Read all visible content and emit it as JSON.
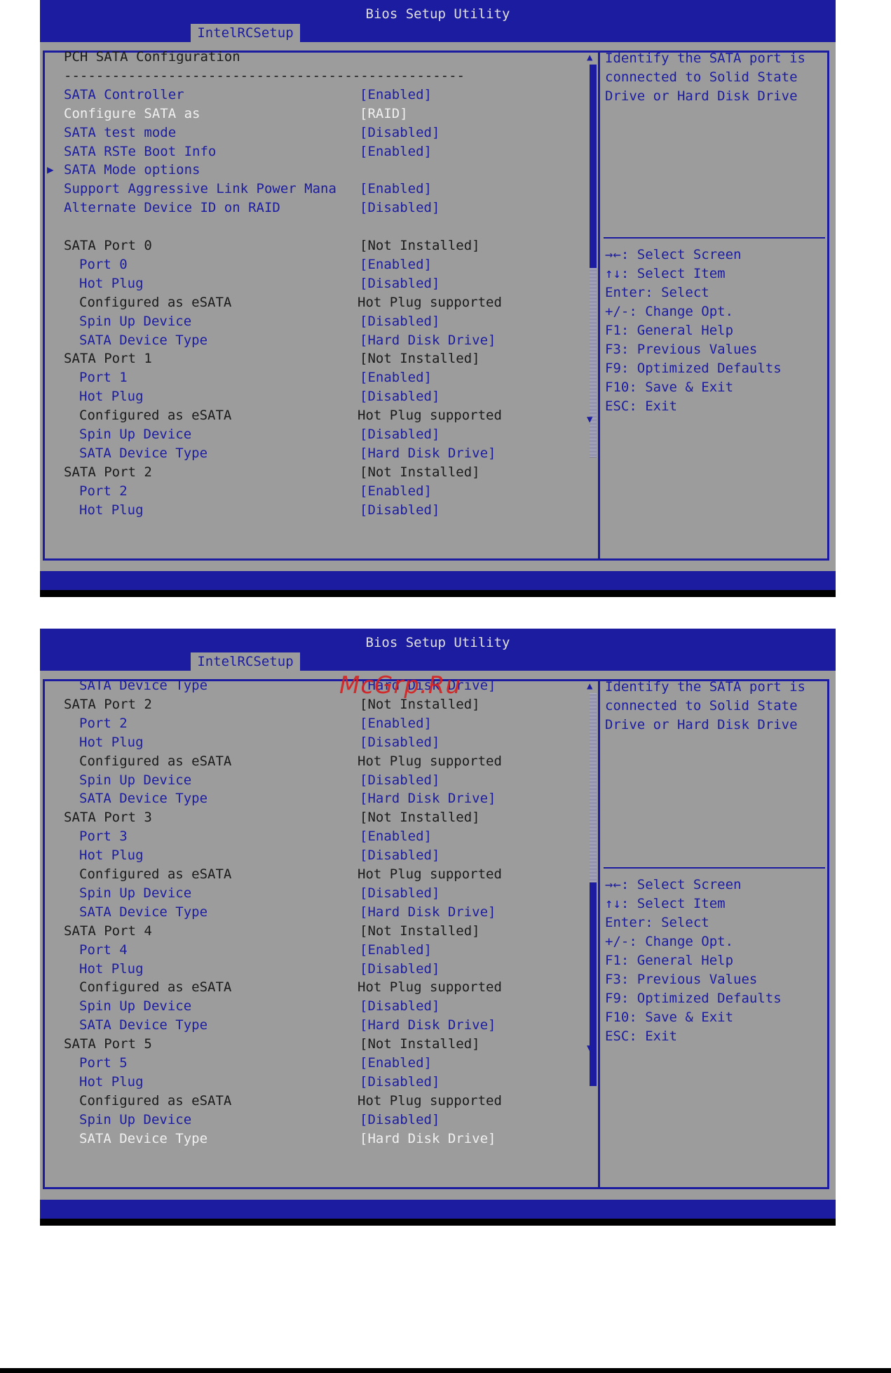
{
  "screen1": {
    "app_title": "Bios Setup Utility",
    "tab_label": "IntelRCSetup",
    "rows": [
      {
        "label": "PCH SATA Configuration",
        "value": "",
        "style": "dark",
        "indent": 0
      },
      {
        "label": "--------------------------------------------------",
        "value": "",
        "style": "dark",
        "indent": 0
      },
      {
        "label": "SATA Controller",
        "value": "[Enabled]",
        "style": "blue",
        "indent": 0
      },
      {
        "label": "Configure SATA as",
        "value": "[RAID]",
        "style": "white",
        "indent": 0
      },
      {
        "label": "SATA test mode",
        "value": "[Disabled]",
        "style": "blue",
        "indent": 0
      },
      {
        "label": "SATA RSTe Boot Info",
        "value": "[Enabled]",
        "style": "blue",
        "indent": 0
      },
      {
        "label": "SATA Mode options",
        "value": "",
        "style": "blue",
        "indent": 0,
        "pointer": "▶"
      },
      {
        "label": "Support Aggressive Link Power Mana",
        "value": "[Enabled]",
        "style": "blue",
        "indent": 0
      },
      {
        "label": "Alternate Device ID on RAID",
        "value": "[Disabled]",
        "style": "blue",
        "indent": 0
      },
      {
        "label": "",
        "value": "",
        "style": "dark",
        "indent": 0
      },
      {
        "label": "SATA Port 0",
        "value": "[Not Installed]",
        "style": "dark",
        "indent": 0
      },
      {
        "label": "Port 0",
        "value": "[Enabled]",
        "style": "blue",
        "indent": 1
      },
      {
        "label": "Hot Plug",
        "value": "[Disabled]",
        "style": "blue",
        "indent": 1
      },
      {
        "label": "Configured as eSATA",
        "value": "Hot Plug supported",
        "style": "dark",
        "indent": 1
      },
      {
        "label": "Spin Up Device",
        "value": "[Disabled]",
        "style": "blue",
        "indent": 1
      },
      {
        "label": "SATA Device Type",
        "value": "[Hard Disk Drive]",
        "style": "blue",
        "indent": 1
      },
      {
        "label": "SATA Port 1",
        "value": "[Not Installed]",
        "style": "dark",
        "indent": 0
      },
      {
        "label": "Port 1",
        "value": "[Enabled]",
        "style": "blue",
        "indent": 1
      },
      {
        "label": "Hot Plug",
        "value": "[Disabled]",
        "style": "blue",
        "indent": 1
      },
      {
        "label": "Configured as eSATA",
        "value": "Hot Plug supported",
        "style": "dark",
        "indent": 1
      },
      {
        "label": "Spin Up Device",
        "value": "[Disabled]",
        "style": "blue",
        "indent": 1
      },
      {
        "label": "SATA Device Type",
        "value": "[Hard Disk Drive]",
        "style": "blue",
        "indent": 1
      },
      {
        "label": "SATA Port 2",
        "value": "[Not Installed]",
        "style": "dark",
        "indent": 0
      },
      {
        "label": "Port 2",
        "value": "[Enabled]",
        "style": "blue",
        "indent": 1
      },
      {
        "label": "Hot Plug",
        "value": "[Disabled]",
        "style": "blue",
        "indent": 1
      }
    ],
    "help_text": "Identify the SATA port is\nconnected to Solid State\nDrive or Hard Disk Drive",
    "keys": [
      "→←: Select Screen",
      "↑↓: Select Item",
      "Enter: Select",
      "+/-: Change Opt.",
      "F1: General Help",
      "F3: Previous Values",
      "F9: Optimized Defaults",
      "F10: Save & Exit",
      "ESC: Exit"
    ],
    "scroll_position": 0.0
  },
  "screen2": {
    "app_title": "Bios Setup Utility",
    "tab_label": "IntelRCSetup",
    "rows": [
      {
        "label": "SATA Device Type",
        "value": "[Hard Disk Drive]",
        "style": "blue",
        "indent": 1
      },
      {
        "label": "SATA Port 2",
        "value": "[Not Installed]",
        "style": "dark",
        "indent": 0
      },
      {
        "label": "Port 2",
        "value": "[Enabled]",
        "style": "blue",
        "indent": 1
      },
      {
        "label": "Hot Plug",
        "value": "[Disabled]",
        "style": "blue",
        "indent": 1
      },
      {
        "label": "Configured as eSATA",
        "value": "Hot Plug supported",
        "style": "dark",
        "indent": 1
      },
      {
        "label": "Spin Up Device",
        "value": "[Disabled]",
        "style": "blue",
        "indent": 1
      },
      {
        "label": "SATA Device Type",
        "value": "[Hard Disk Drive]",
        "style": "blue",
        "indent": 1
      },
      {
        "label": "SATA Port 3",
        "value": "[Not Installed]",
        "style": "dark",
        "indent": 0
      },
      {
        "label": "Port 3",
        "value": "[Enabled]",
        "style": "blue",
        "indent": 1
      },
      {
        "label": "Hot Plug",
        "value": "[Disabled]",
        "style": "blue",
        "indent": 1
      },
      {
        "label": "Configured as eSATA",
        "value": "Hot Plug supported",
        "style": "dark",
        "indent": 1
      },
      {
        "label": "Spin Up Device",
        "value": "[Disabled]",
        "style": "blue",
        "indent": 1
      },
      {
        "label": "SATA Device Type",
        "value": "[Hard Disk Drive]",
        "style": "blue",
        "indent": 1
      },
      {
        "label": "SATA Port 4",
        "value": "[Not Installed]",
        "style": "dark",
        "indent": 0
      },
      {
        "label": "Port 4",
        "value": "[Enabled]",
        "style": "blue",
        "indent": 1
      },
      {
        "label": "Hot Plug",
        "value": "[Disabled]",
        "style": "blue",
        "indent": 1
      },
      {
        "label": "Configured as eSATA",
        "value": "Hot Plug supported",
        "style": "dark",
        "indent": 1
      },
      {
        "label": "Spin Up Device",
        "value": "[Disabled]",
        "style": "blue",
        "indent": 1
      },
      {
        "label": "SATA Device Type",
        "value": "[Hard Disk Drive]",
        "style": "blue",
        "indent": 1
      },
      {
        "label": "SATA Port 5",
        "value": "[Not Installed]",
        "style": "dark",
        "indent": 0
      },
      {
        "label": "Port 5",
        "value": "[Enabled]",
        "style": "blue",
        "indent": 1
      },
      {
        "label": "Hot Plug",
        "value": "[Disabled]",
        "style": "blue",
        "indent": 1
      },
      {
        "label": "Configured as eSATA",
        "value": "Hot Plug supported",
        "style": "dark",
        "indent": 1
      },
      {
        "label": "Spin Up Device",
        "value": "[Disabled]",
        "style": "blue",
        "indent": 1
      },
      {
        "label": "SATA Device Type",
        "value": "[Hard Disk Drive]",
        "style": "white",
        "indent": 1
      }
    ],
    "help_text": "Identify the SATA port is\nconnected to Solid State\nDrive or Hard Disk Drive",
    "keys": [
      "→←: Select Screen",
      "↑↓: Select Item",
      "Enter: Select",
      "+/-: Change Opt.",
      "F1: General Help",
      "F3: Previous Values",
      "F9: Optimized Defaults",
      "F10: Save & Exit",
      "ESC: Exit"
    ],
    "scroll_position": 1.0
  },
  "watermark": "McGrp.Ru",
  "colors": {
    "bios_blue": "#1c1ca0",
    "panel_gray": "#9c9c9c",
    "highlight_white": "#f0f0f0",
    "watermark_red": "#d62020"
  },
  "icons": {
    "submenu_pointer": "triangle-right-icon",
    "scroll_up": "triangle-up-icon",
    "scroll_down": "triangle-down-icon"
  }
}
